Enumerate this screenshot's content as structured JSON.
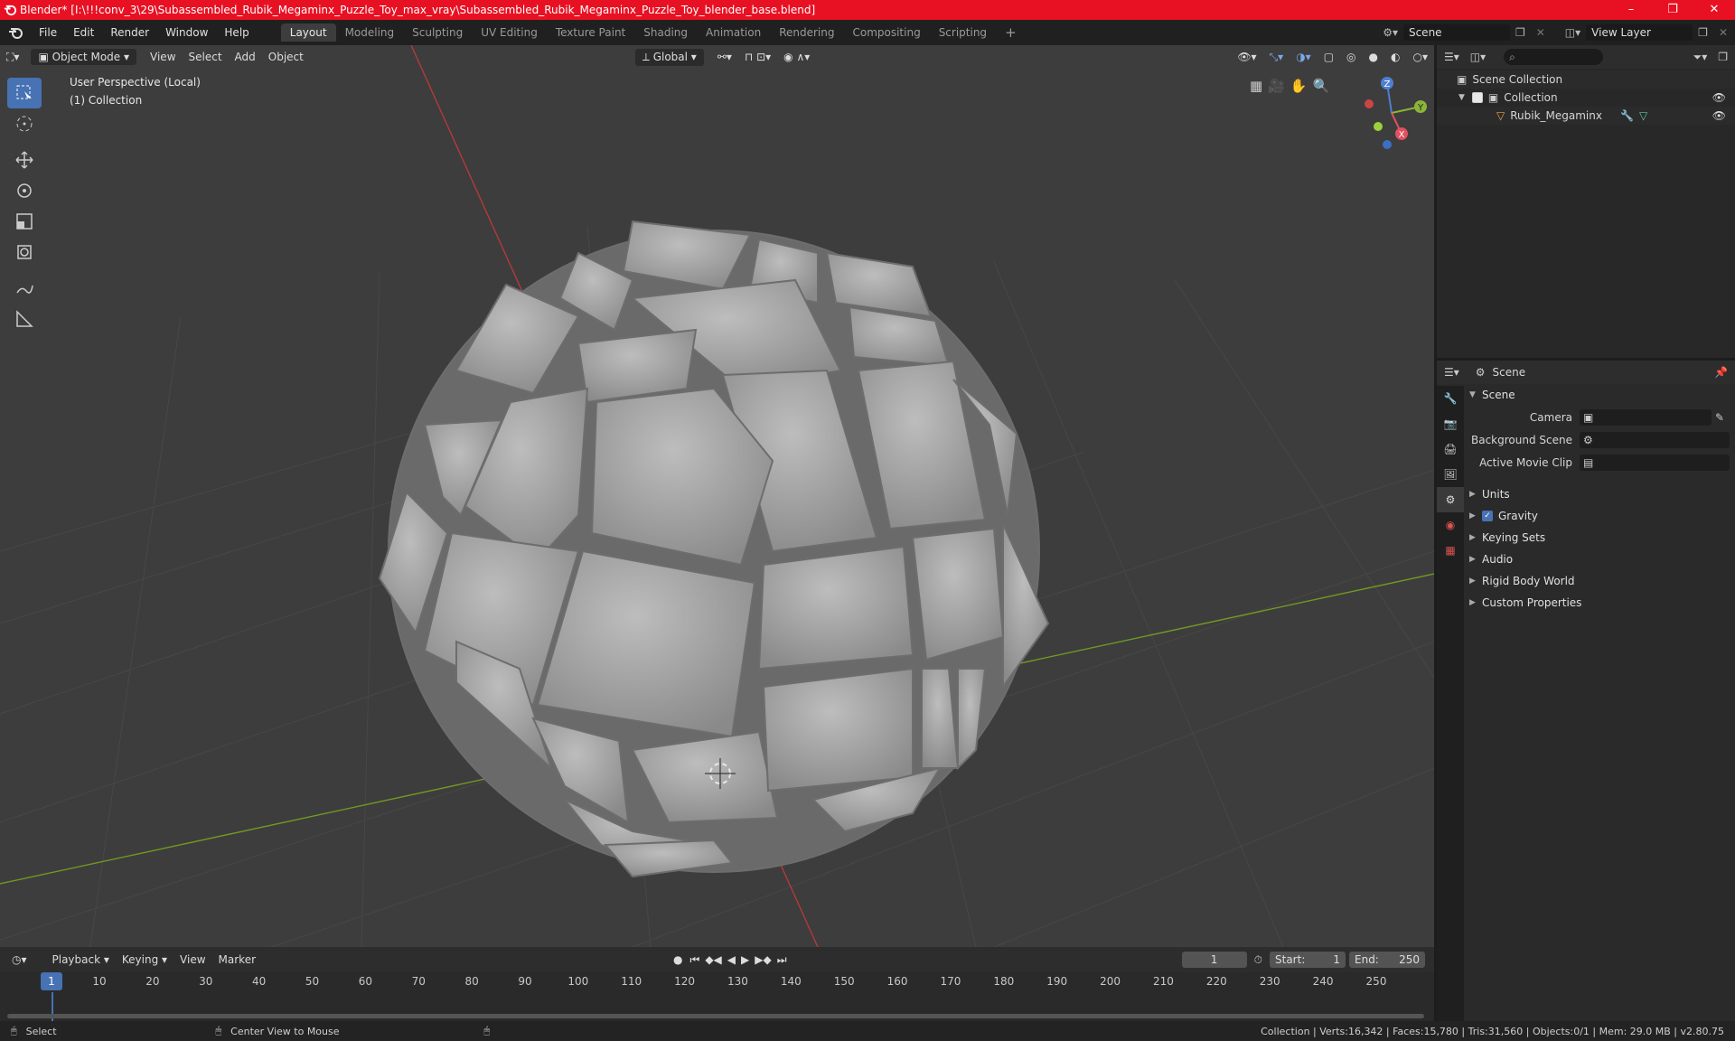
{
  "window": {
    "title": "Blender* [I:\\!!!conv_3\\29\\Subassembled_Rubik_Megaminx_Puzzle_Toy_max_vray\\Subassembled_Rubik_Megaminx_Puzzle_Toy_blender_base.blend]",
    "minimize": "–",
    "maximize": "❐",
    "close": "✕"
  },
  "menus": [
    "File",
    "Edit",
    "Render",
    "Window",
    "Help"
  ],
  "workspaces": [
    "Layout",
    "Modeling",
    "Sculpting",
    "UV Editing",
    "Texture Paint",
    "Shading",
    "Animation",
    "Rendering",
    "Compositing",
    "Scripting"
  ],
  "topright": {
    "scene": "Scene",
    "view_layer": "View Layer"
  },
  "viewport": {
    "mode": "Object Mode",
    "menu": [
      "View",
      "Select",
      "Add",
      "Object"
    ],
    "orientation": "Global",
    "perspective": "User Perspective (Local)",
    "collection": "(1) Collection",
    "gizmo": {
      "z": "Z",
      "y": "Y",
      "x": "X"
    }
  },
  "outliner": {
    "root": "Scene Collection",
    "collection": "Collection",
    "object": "Rubik_Megaminx"
  },
  "properties": {
    "header": "Scene",
    "panel": "Scene",
    "camera_label": "Camera",
    "bg_scene_label": "Background Scene",
    "movie_clip_label": "Active Movie Clip",
    "sections": [
      "Units",
      "Gravity",
      "Keying Sets",
      "Audio",
      "Rigid Body World",
      "Custom Properties"
    ]
  },
  "timeline": {
    "menu": [
      "Playback",
      "Keying",
      "View",
      "Marker"
    ],
    "current_frame": "1",
    "start_label": "Start:",
    "start": "1",
    "end_label": "End:",
    "end": "250",
    "ticks": [
      "1",
      "10",
      "20",
      "30",
      "40",
      "50",
      "60",
      "70",
      "80",
      "90",
      "100",
      "110",
      "120",
      "130",
      "140",
      "150",
      "160",
      "170",
      "180",
      "190",
      "200",
      "210",
      "220",
      "230",
      "240",
      "250"
    ]
  },
  "status": {
    "select": "Select",
    "center_view": "Center View to Mouse",
    "stats": "Collection | Verts:16,342 | Faces:15,780 | Tris:31,560 | Objects:0/1 | Mem: 29.0 MB | v2.80.75"
  },
  "colors": {
    "accent": "#4772b3",
    "titlebar": "#e81123",
    "grid_x": "#b33a3a",
    "grid_y": "#6f9a23"
  }
}
